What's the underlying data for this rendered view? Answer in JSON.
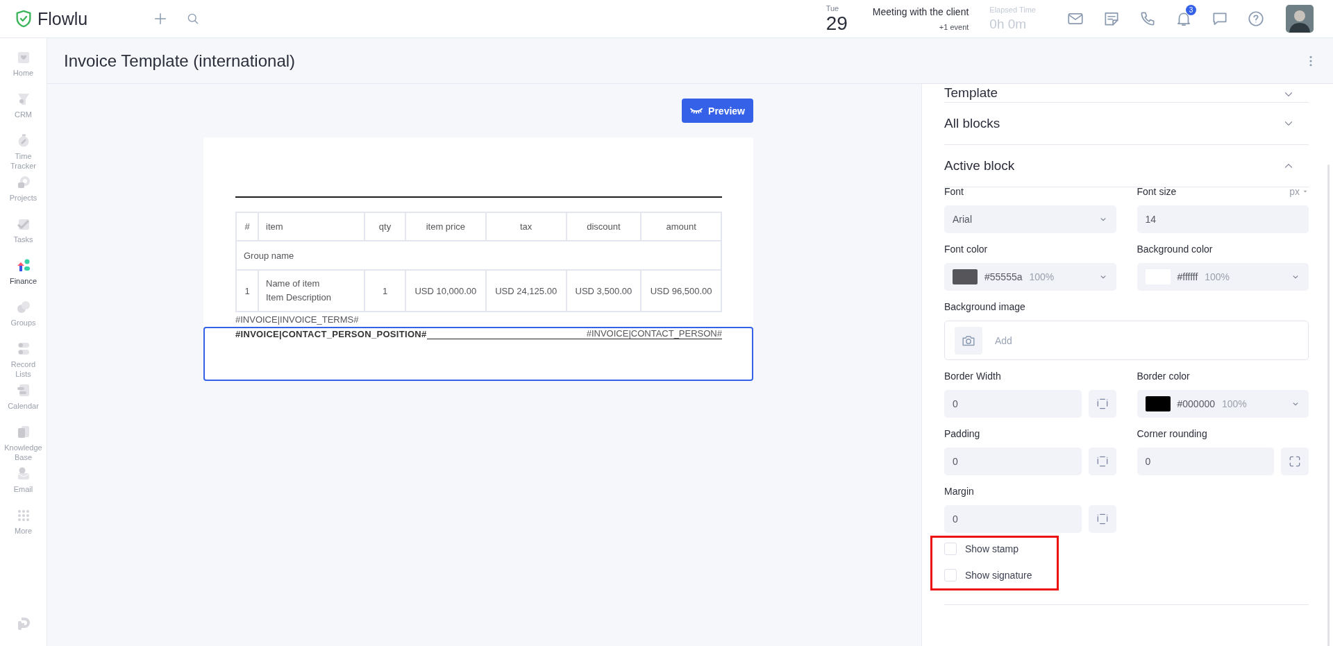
{
  "app": {
    "name": "Flowlu"
  },
  "topbar": {
    "date": {
      "weekday": "Tue",
      "day": "29"
    },
    "event": {
      "title": "Meeting with the client",
      "more": "+1 event"
    },
    "timer": {
      "label": "Elapsed Time",
      "value": "0h 0m"
    },
    "notifications_badge": "3"
  },
  "sidebar": {
    "items": [
      {
        "label": "Home",
        "selected": false
      },
      {
        "label": "CRM",
        "selected": false
      },
      {
        "label": "Time Tracker",
        "selected": false
      },
      {
        "label": "Projects",
        "selected": false
      },
      {
        "label": "Tasks",
        "selected": false
      },
      {
        "label": "Finance",
        "selected": true
      },
      {
        "label": "Groups",
        "selected": false
      },
      {
        "label": "Record Lists",
        "selected": false
      },
      {
        "label": "Calendar",
        "selected": false
      },
      {
        "label": "Knowledge Base",
        "selected": false
      },
      {
        "label": "Email",
        "selected": false
      },
      {
        "label": "More",
        "selected": false
      }
    ]
  },
  "page": {
    "title": "Invoice Template (international)"
  },
  "editor": {
    "preview_button": "Preview",
    "table": {
      "columns": [
        "#",
        "item",
        "qty",
        "item price",
        "tax",
        "discount",
        "amount"
      ],
      "group_row": "Group name",
      "rows": [
        {
          "number": "1",
          "name": "Name of item",
          "description": "Item Description",
          "qty": "1",
          "price": "USD 10,000.00",
          "tax": "USD 24,125.00",
          "discount": "USD 3,500.00",
          "amount": "USD 96,500.00"
        }
      ]
    },
    "terms": "#INVOICE|INVOICE_TERMS#",
    "signature": {
      "position": "#INVOICE|CONTACT_PERSON_POSITION#",
      "person": "#INVOICE|CONTACT_PERSON#",
      "selected": true
    }
  },
  "panel": {
    "sections": [
      {
        "title": "Template",
        "expanded": false
      },
      {
        "title": "All blocks",
        "expanded": false
      },
      {
        "title": "Active block",
        "expanded": true
      }
    ],
    "fields": [
      {
        "kind": "select",
        "label": "Font",
        "value": "Arial"
      },
      {
        "kind": "input",
        "label": "Font size",
        "value": "14",
        "unit": "px"
      },
      {
        "kind": "color",
        "label": "Font color",
        "color": "#55555a",
        "value": "#55555a",
        "opacity": "100%"
      },
      {
        "kind": "color",
        "label": "Background color",
        "color": "#ffffff",
        "value": "#ffffff",
        "opacity": "100%"
      },
      {
        "kind": "image",
        "label": "Background image",
        "action": "Add"
      },
      {
        "kind": "sides",
        "label": "Border Width",
        "value": "0"
      },
      {
        "kind": "color",
        "label": "Border color",
        "color": "#000000",
        "value": "#000000",
        "opacity": "100%"
      },
      {
        "kind": "sides",
        "label": "Padding",
        "value": "0"
      },
      {
        "kind": "corners",
        "label": "Corner rounding",
        "value": "0"
      },
      {
        "kind": "sides",
        "label": "Margin",
        "value": "0"
      }
    ],
    "checkboxes": [
      {
        "label": "Show stamp",
        "checked": false
      },
      {
        "label": "Show signature",
        "checked": false
      }
    ]
  }
}
